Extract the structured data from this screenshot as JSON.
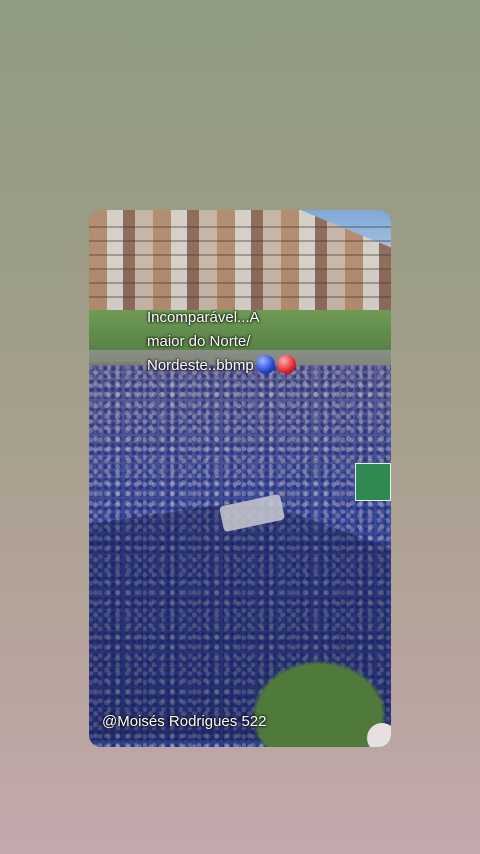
{
  "story": {
    "caption_lines": [
      "Incomparável...A",
      "maior do Norte/",
      "Nordeste..bbmp"
    ],
    "caption_emojis": [
      "blue-ball",
      "red-ball"
    ],
    "credit": "@Moisés  Rodrigues 522"
  },
  "colors": {
    "background_top": "#8f9b84",
    "background_bottom": "#c3a9ac",
    "crowd_blue": "#3b4a9a",
    "team_blue": "#2447d8",
    "team_red": "#e0232b"
  }
}
